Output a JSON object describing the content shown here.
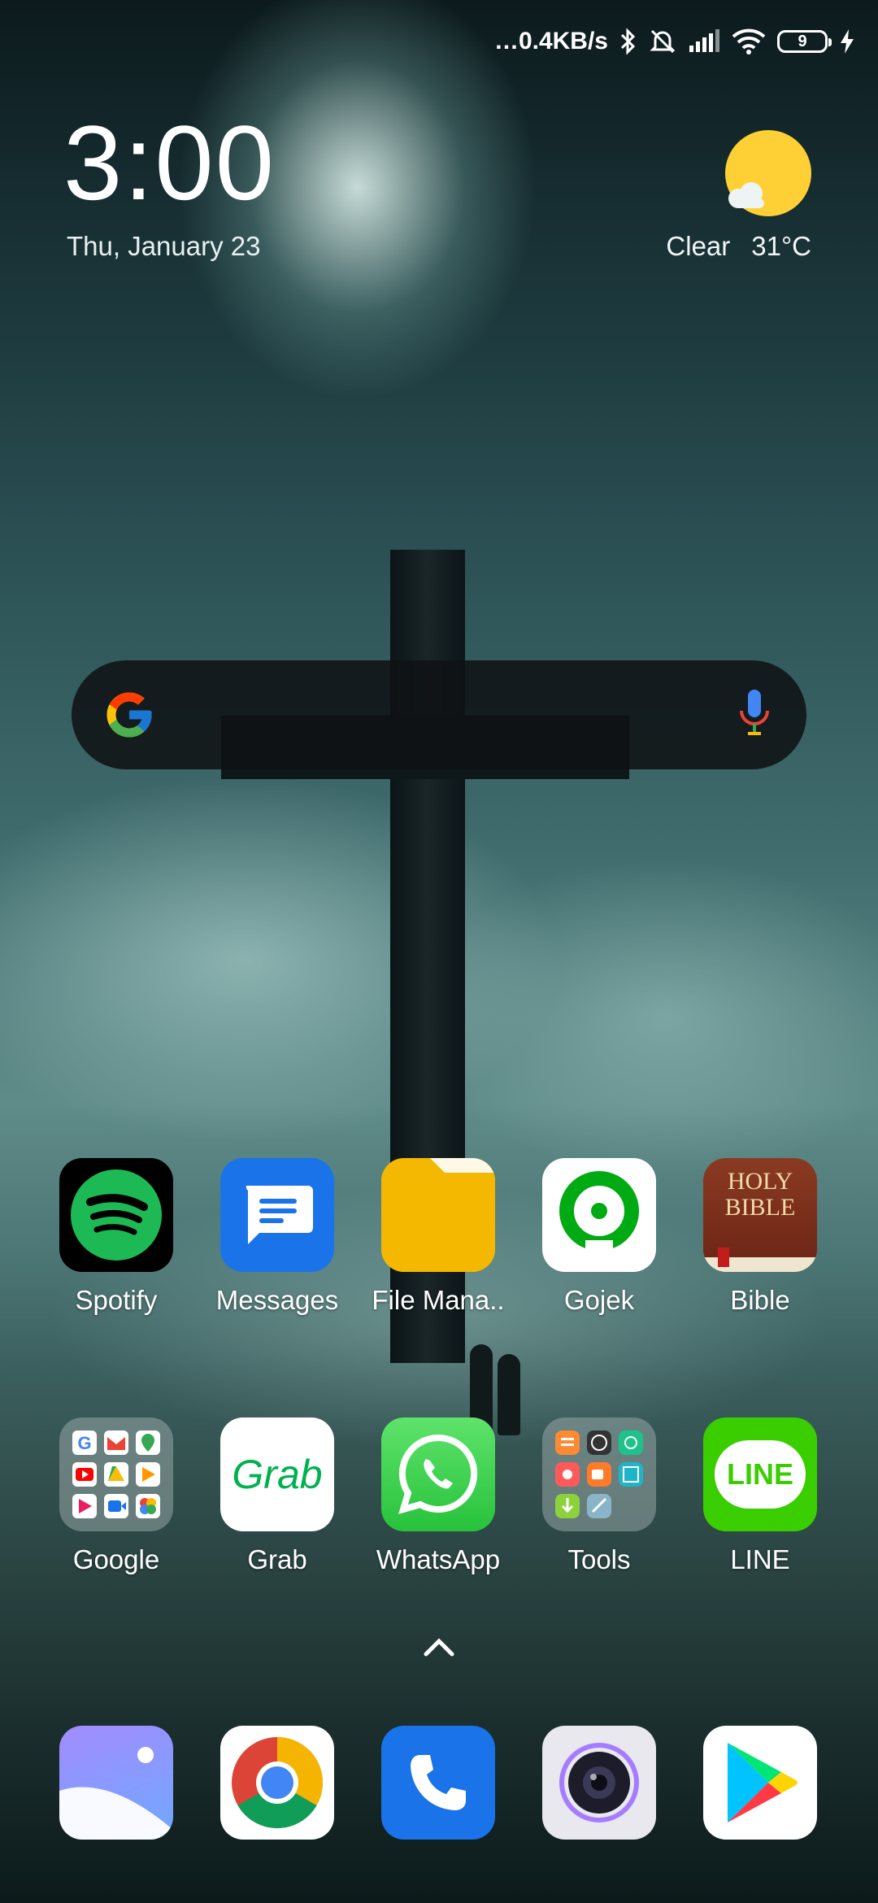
{
  "status_bar": {
    "net_speed": "…0.4KB/s",
    "battery_level": "9",
    "icons": [
      "bluetooth-icon",
      "mute-icon",
      "signal-icon",
      "wifi-icon",
      "battery-icon",
      "charging-icon"
    ]
  },
  "clock": {
    "time": "3:00",
    "date": "Thu, January 23"
  },
  "weather": {
    "condition": "Clear",
    "temperature": "31°C"
  },
  "search_bar": {
    "logo": "google-g-icon",
    "mic": "mic-icon"
  },
  "apps_row1": [
    {
      "label": "Spotify",
      "icon": "spotify-icon"
    },
    {
      "label": "Messages",
      "icon": "messages-icon"
    },
    {
      "label": "File Mana..",
      "icon": "folder-icon"
    },
    {
      "label": "Gojek",
      "icon": "gojek-icon"
    },
    {
      "label": "Bible",
      "icon": "bible-icon",
      "icon_text": [
        "HOLY",
        "BIBLE"
      ]
    }
  ],
  "apps_row2": [
    {
      "label": "Google",
      "icon": "google-folder-icon"
    },
    {
      "label": "Grab",
      "icon": "grab-icon",
      "icon_text": "Grab"
    },
    {
      "label": "WhatsApp",
      "icon": "whatsapp-icon"
    },
    {
      "label": "Tools",
      "icon": "tools-folder-icon"
    },
    {
      "label": "LINE",
      "icon": "line-icon",
      "icon_text": "LINE"
    }
  ],
  "dock": [
    {
      "name": "gallery",
      "icon": "gallery-icon"
    },
    {
      "name": "chrome",
      "icon": "chrome-icon"
    },
    {
      "name": "phone",
      "icon": "phone-icon"
    },
    {
      "name": "camera",
      "icon": "camera-icon"
    },
    {
      "name": "play-store",
      "icon": "play-store-icon"
    }
  ],
  "colors": {
    "accent_spotify": "#1db954",
    "messages": "#1a73e8",
    "files": "#f5b800",
    "gojek": "#00aa13",
    "whatsapp": "#25d366",
    "line": "#3ace01",
    "sun": "#ffd035"
  }
}
